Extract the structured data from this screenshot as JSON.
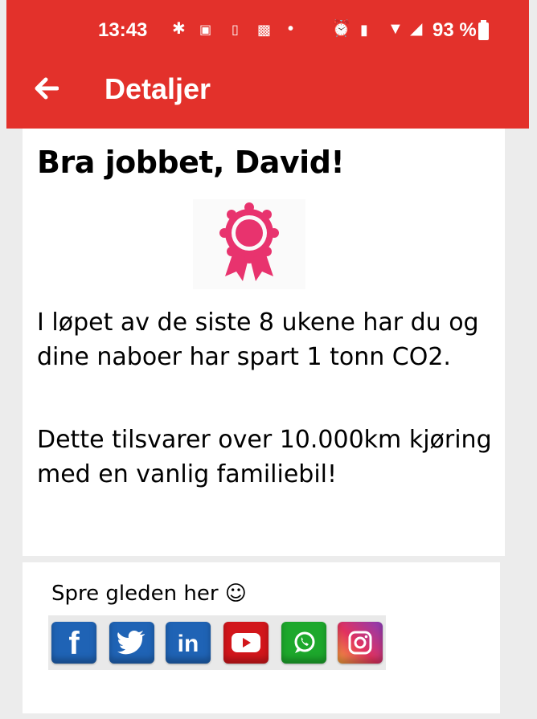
{
  "status_bar": {
    "time": "13:43",
    "battery_text": "93 %",
    "icons": [
      "bluetooth-icon",
      "email-icon",
      "sim-icon",
      "image-icon",
      "dot-icon",
      "alarm-icon",
      "vibrate-icon",
      "wifi-icon",
      "signal-icon",
      "battery-icon"
    ]
  },
  "app_bar": {
    "title": "Detaljer",
    "back_icon": "arrow-left-icon",
    "color": "#e3312b"
  },
  "main": {
    "headline": "Bra jobbet, David!",
    "award_icon": "award-ribbon-icon",
    "award_color": "#e8336e",
    "paragraph1": "I løpet av de siste 8 ukene har du og dine naboer har spart 1 tonn CO2.",
    "paragraph2": "Dette tilsvarer over 10.000km kjøring med en vanlig familiebil!"
  },
  "share": {
    "label": "Spre gleden her ☺",
    "buttons": [
      {
        "name": "facebook-icon",
        "glyph": "f",
        "color": "#1f63b5"
      },
      {
        "name": "twitter-icon",
        "glyph": "",
        "color": "#1f63b5"
      },
      {
        "name": "linkedin-icon",
        "glyph": "in",
        "color": "#1f63b5"
      },
      {
        "name": "youtube-icon",
        "glyph": "",
        "color": "#d2161b"
      },
      {
        "name": "whatsapp-icon",
        "glyph": "",
        "color": "#1da82c"
      },
      {
        "name": "instagram-icon",
        "glyph": "",
        "color": "#b43a9a"
      }
    ]
  }
}
